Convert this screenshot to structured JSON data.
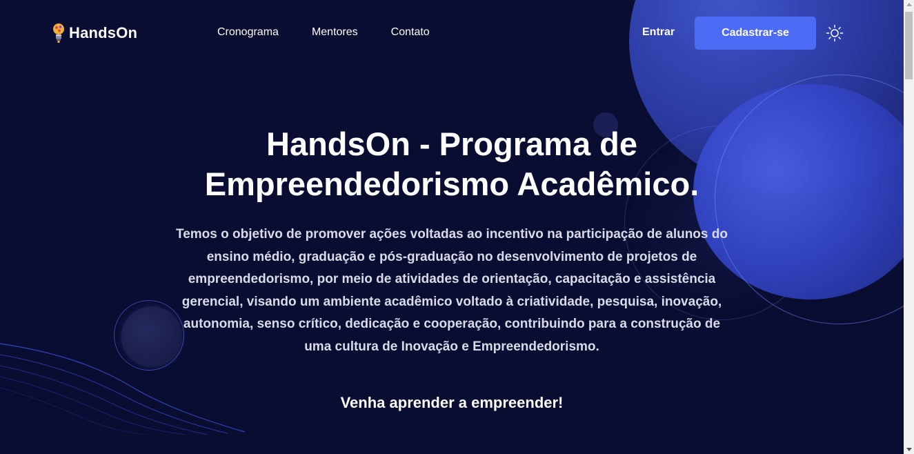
{
  "header": {
    "logo_text": "HandsOn",
    "nav": {
      "schedule": "Cronograma",
      "mentors": "Mentores",
      "contact": "Contato"
    },
    "login_label": "Entrar",
    "signup_label": "Cadastrar-se",
    "theme_icon": "sun-icon"
  },
  "hero": {
    "title_line1": "HandsOn - Programa de",
    "title_line2": "Empreendedorismo Acadêmico.",
    "description": "Temos o objetivo de promover ações voltadas ao incentivo na participação de alunos do ensino médio, graduação e pós-graduação no desenvolvimento de projetos de empreendedorismo, por meio de atividades de orientação, capacitação e assistência gerencial, visando um ambiente acadêmico voltado à criatividade, pesquisa, inovação, autonomia, senso crítico, dedicação e cooperação, contribuindo para a construção de uma cultura de Inovação e Empreendedorismo.",
    "cta": "Venha aprender a empreender!"
  },
  "colors": {
    "background": "#090d31",
    "accent": "#4d6cf5",
    "text": "#ffffff",
    "muted_text": "#d8dbe8"
  }
}
